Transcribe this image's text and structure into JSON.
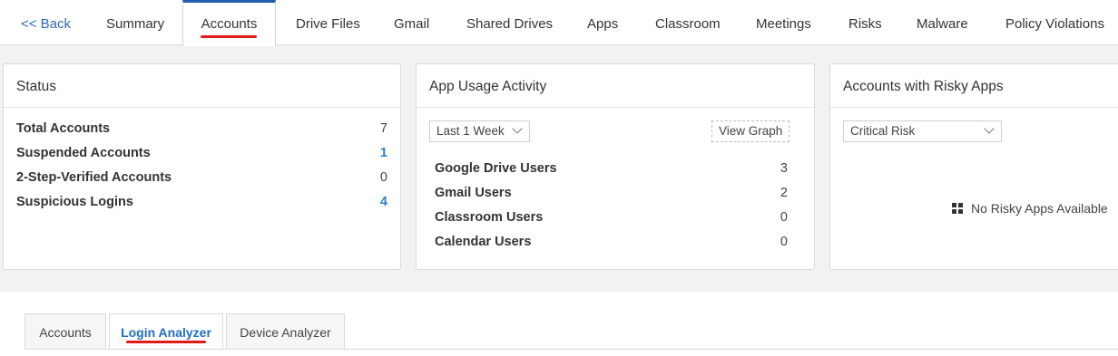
{
  "nav": {
    "back": "<< Back",
    "tabs": [
      "Summary",
      "Accounts",
      "Drive Files",
      "Gmail",
      "Shared Drives",
      "Apps",
      "Classroom",
      "Meetings",
      "Risks",
      "Malware",
      "Policy Violations"
    ],
    "active": "Accounts"
  },
  "status_card": {
    "title": "Status",
    "rows": [
      {
        "label": "Total Accounts",
        "value": "7"
      },
      {
        "label": "Suspended Accounts",
        "value": "1"
      },
      {
        "label": "2-Step-Verified Accounts",
        "value": "0"
      },
      {
        "label": "Suspicious Logins",
        "value": "4"
      }
    ]
  },
  "usage_card": {
    "title": "App Usage Activity",
    "period_select": "Last 1 Week",
    "view_graph": "View Graph",
    "rows": [
      {
        "label": "Google Drive Users",
        "value": "3"
      },
      {
        "label": "Gmail Users",
        "value": "2"
      },
      {
        "label": "Classroom Users",
        "value": "0"
      },
      {
        "label": "Calendar Users",
        "value": "0"
      }
    ]
  },
  "risky_card": {
    "title": "Accounts with Risky Apps",
    "risk_select": "Critical Risk",
    "empty_message": "No Risky Apps Available"
  },
  "subtabs": {
    "items": [
      "Accounts",
      "Login Analyzer",
      "Device Analyzer"
    ],
    "active": "Login Analyzer"
  },
  "colors": {
    "accent": "#1f5fb0",
    "link": "#2a7dd1",
    "highlight_underline": "#e01919"
  }
}
